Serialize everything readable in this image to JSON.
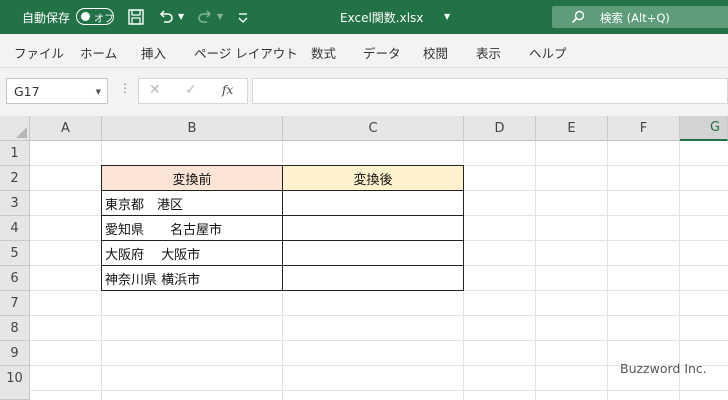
{
  "titlebar": {
    "autosave_label": "自動保存",
    "autosave_state": "オフ",
    "file_title": "Excel関数.xlsx",
    "search_text": "検索 (Alt+Q)"
  },
  "ribbon": {
    "tabs": [
      "ファイル",
      "ホーム",
      "挿入",
      "ページ レイアウト",
      "数式",
      "データ",
      "校閲",
      "表示",
      "ヘルプ"
    ]
  },
  "formula_bar": {
    "name_box": "G17",
    "function_label": "fx",
    "formula_value": ""
  },
  "grid": {
    "columns": [
      "A",
      "B",
      "C",
      "D",
      "E",
      "F",
      "G"
    ],
    "selected_column": "G",
    "rows": [
      "1",
      "2",
      "3",
      "4",
      "5",
      "6",
      "7",
      "8",
      "9",
      "10"
    ],
    "table": {
      "header_before": "変換前",
      "header_after": "変換後",
      "before_values": [
        "東京都　港区",
        "愛知県　　名古屋市",
        "大阪府　 大阪市",
        "神奈川県 横浜市"
      ],
      "after_values": [
        "",
        "",
        "",
        ""
      ]
    }
  },
  "watermark": "Buzzword Inc.",
  "colors": {
    "excel_green": "#217346",
    "header_before_fill": "#fce4d6",
    "header_after_fill": "#fff2cc"
  }
}
